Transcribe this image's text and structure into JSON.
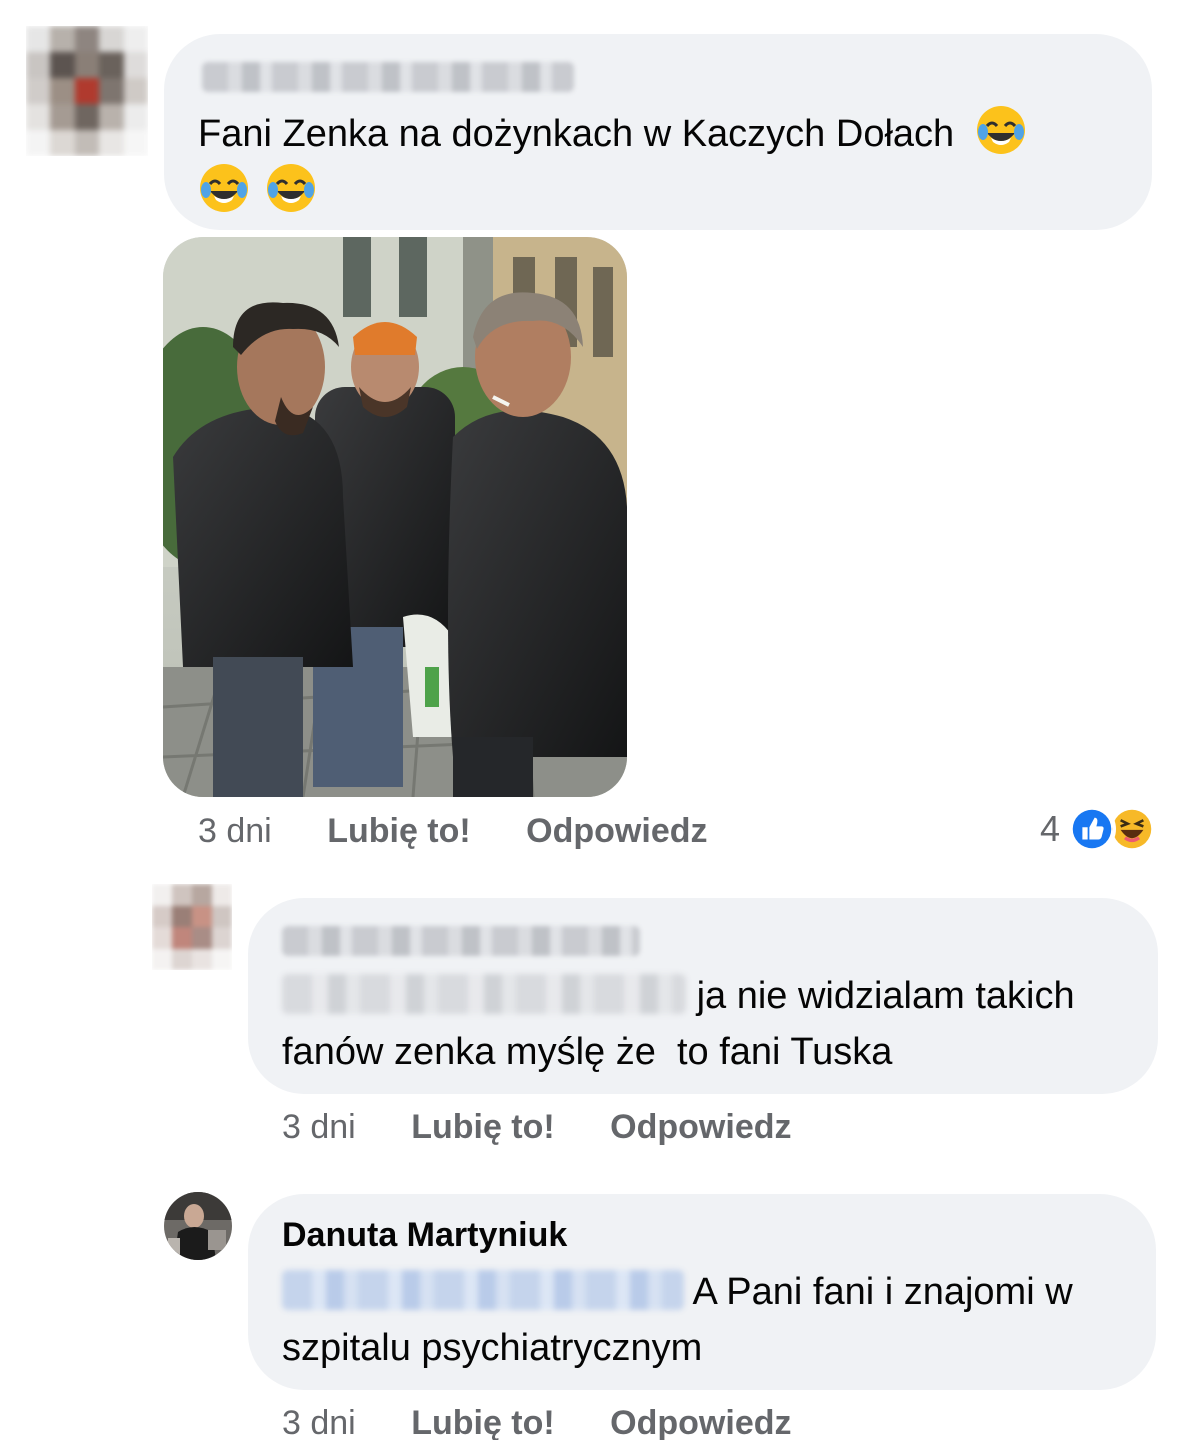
{
  "comments": [
    {
      "author": "",
      "text": "Fani Zenka na dożynkach w Kaczych Dołach",
      "emojis": [
        "face-with-tears-of-joy",
        "face-with-tears-of-joy",
        "face-with-tears-of-joy"
      ],
      "time": "3 dni",
      "like_label": "Lubię to!",
      "reply_label": "Odpowiedz",
      "reaction_count": "4",
      "reaction_icons": [
        "like-icon",
        "haha-icon"
      ]
    },
    {
      "author": "",
      "text": "ja nie widzialam takich fanów zenka myślę że  to fani Tuska",
      "text_line1": "ja nie widzialam takich",
      "text_line2": "fanów zenka myślę że  to fani Tuska",
      "time": "3 dni",
      "like_label": "Lubię to!",
      "reply_label": "Odpowiedz"
    },
    {
      "author": "Danuta Martyniuk",
      "text": "A Pani fani i znajomi w szpitalu psychiatrycznym",
      "text_line1": "A Pani fani i znajomi w",
      "text_line2": "szpitalu psychiatrycznym",
      "time": "3 dni",
      "like_label": "Lubię to!",
      "reply_label": "Odpowiedz"
    }
  ],
  "colors": {
    "bubble": "#f0f2f5",
    "meta_text": "#65676b",
    "like_blue": "#1877f2",
    "haha_yellow": "#f7b928"
  }
}
